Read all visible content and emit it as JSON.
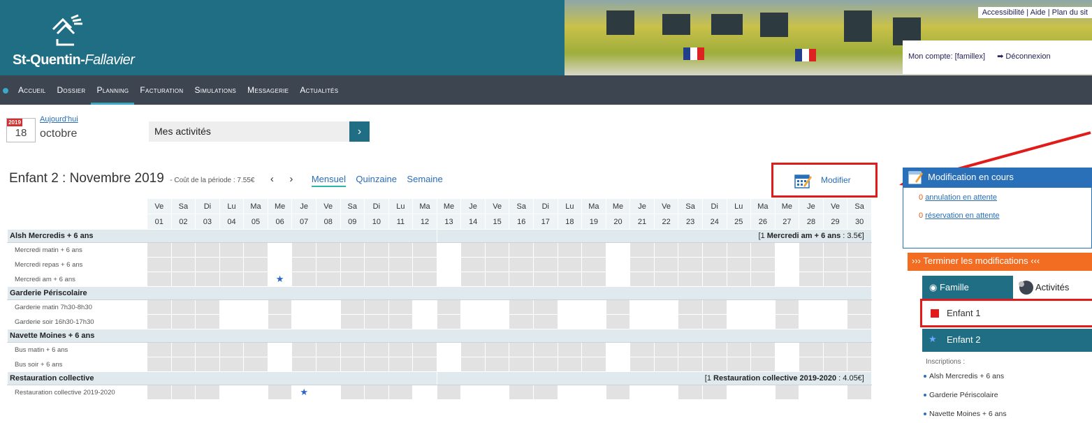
{
  "header": {
    "logo_text_bold": "St-Quentin-",
    "logo_text_italic": "Fallavier",
    "top_links": [
      "Accessibilité",
      "Aide",
      "Plan du sit"
    ],
    "account_label": "Mon compte: [famillex]",
    "logout_label": "Déconnexion"
  },
  "nav": {
    "items": [
      "Accueil",
      "Dossier",
      "Planning",
      "Facturation",
      "Simulations",
      "Messagerie",
      "Actualités"
    ],
    "active": "Planning"
  },
  "date": {
    "year": "2019",
    "day": "18",
    "month": "octobre",
    "today_link": "Aujourd'hui"
  },
  "activities": {
    "selected": "Mes activités",
    "go": "›"
  },
  "period": {
    "title": "Enfant 2 : Novembre 2019",
    "cost": "- Coût de la période : 7.55€",
    "prev": "‹",
    "next": "›",
    "views": [
      "Mensuel",
      "Quinzaine",
      "Semaine"
    ],
    "selected_view": "Mensuel",
    "modify_label": "Modifier"
  },
  "calendar": {
    "weekdays": [
      "Ve",
      "Sa",
      "Di",
      "Lu",
      "Ma",
      "Me",
      "Je",
      "Ve",
      "Sa",
      "Di",
      "Lu",
      "Ma",
      "Me",
      "Je",
      "Ve",
      "Sa",
      "Di",
      "Lu",
      "Ma",
      "Me",
      "Je",
      "Ve",
      "Sa",
      "Di",
      "Lu",
      "Ma",
      "Me",
      "Je",
      "Ve",
      "Sa"
    ],
    "days": [
      "01",
      "02",
      "03",
      "04",
      "05",
      "06",
      "07",
      "08",
      "09",
      "10",
      "11",
      "12",
      "13",
      "14",
      "15",
      "16",
      "17",
      "18",
      "19",
      "20",
      "21",
      "22",
      "23",
      "24",
      "25",
      "26",
      "27",
      "28",
      "29",
      "30"
    ],
    "sections": [
      {
        "name": "Alsh Mercredis + 6 ans",
        "summary_prefix": "[1 ",
        "summary_bold": "Mercredi am + 6 ans",
        "summary_suffix": " : 3.5€]",
        "rows": [
          {
            "label": "Mercredi matin + 6 ans",
            "open": [
              6,
              13,
              20,
              27
            ],
            "booked": []
          },
          {
            "label": "Mercredi repas + 6 ans",
            "open": [
              6,
              13,
              20,
              27
            ],
            "booked": []
          },
          {
            "label": "Mercredi am + 6 ans",
            "open": [
              6,
              13,
              20,
              27
            ],
            "booked": [
              6
            ]
          }
        ]
      },
      {
        "name": "Garderie Périscolaire",
        "summary_prefix": "",
        "summary_bold": "",
        "summary_suffix": "",
        "rows": [
          {
            "label": "Garderie matin 7h30-8h30",
            "open": [
              4,
              5,
              7,
              8,
              12,
              14,
              15,
              18,
              19,
              21,
              22,
              25,
              26,
              28,
              29
            ],
            "booked": []
          },
          {
            "label": "Garderie soir 16h30-17h30",
            "open": [
              4,
              5,
              7,
              8,
              12,
              14,
              15,
              18,
              19,
              21,
              22,
              25,
              26,
              28,
              29
            ],
            "booked": []
          }
        ]
      },
      {
        "name": "Navette Moines + 6 ans",
        "summary_prefix": "",
        "summary_bold": "",
        "summary_suffix": "",
        "rows": [
          {
            "label": "Bus matin + 6 ans",
            "open": [
              6,
              13,
              20,
              27
            ],
            "booked": []
          },
          {
            "label": "Bus soir + 6 ans",
            "open": [
              6,
              13,
              20,
              27
            ],
            "booked": []
          }
        ]
      },
      {
        "name": "Restauration collective",
        "summary_prefix": "[1 ",
        "summary_bold": "Restauration collective 2019-2020",
        "summary_suffix": " : 4.05€]",
        "rows": [
          {
            "label": "Restauration collective 2019-2020",
            "open": [
              4,
              5,
              7,
              8,
              12,
              14,
              15,
              18,
              19,
              21,
              22,
              25,
              26,
              28,
              29
            ],
            "booked": [
              7
            ]
          }
        ]
      }
    ]
  },
  "panel": {
    "mod_title": "Modification en cours",
    "cancel_count": "0",
    "cancel_text": "annulation en attente",
    "resa_count": "0",
    "resa_text": "réservation en attente",
    "finish_label": "››› Terminer les modifications ‹‹‹",
    "tab_family": "Famille",
    "tab_activities": "Activités",
    "children": [
      "Enfant 1",
      "Enfant 2"
    ],
    "registrations_title": "Inscriptions :",
    "registrations": [
      "Alsh Mercredis + 6 ans",
      "Garderie Périscolaire",
      "Navette Moines + 6 ans"
    ],
    "colors": {
      "child1": "#e21a1a",
      "child2": "#2b63c8"
    }
  }
}
